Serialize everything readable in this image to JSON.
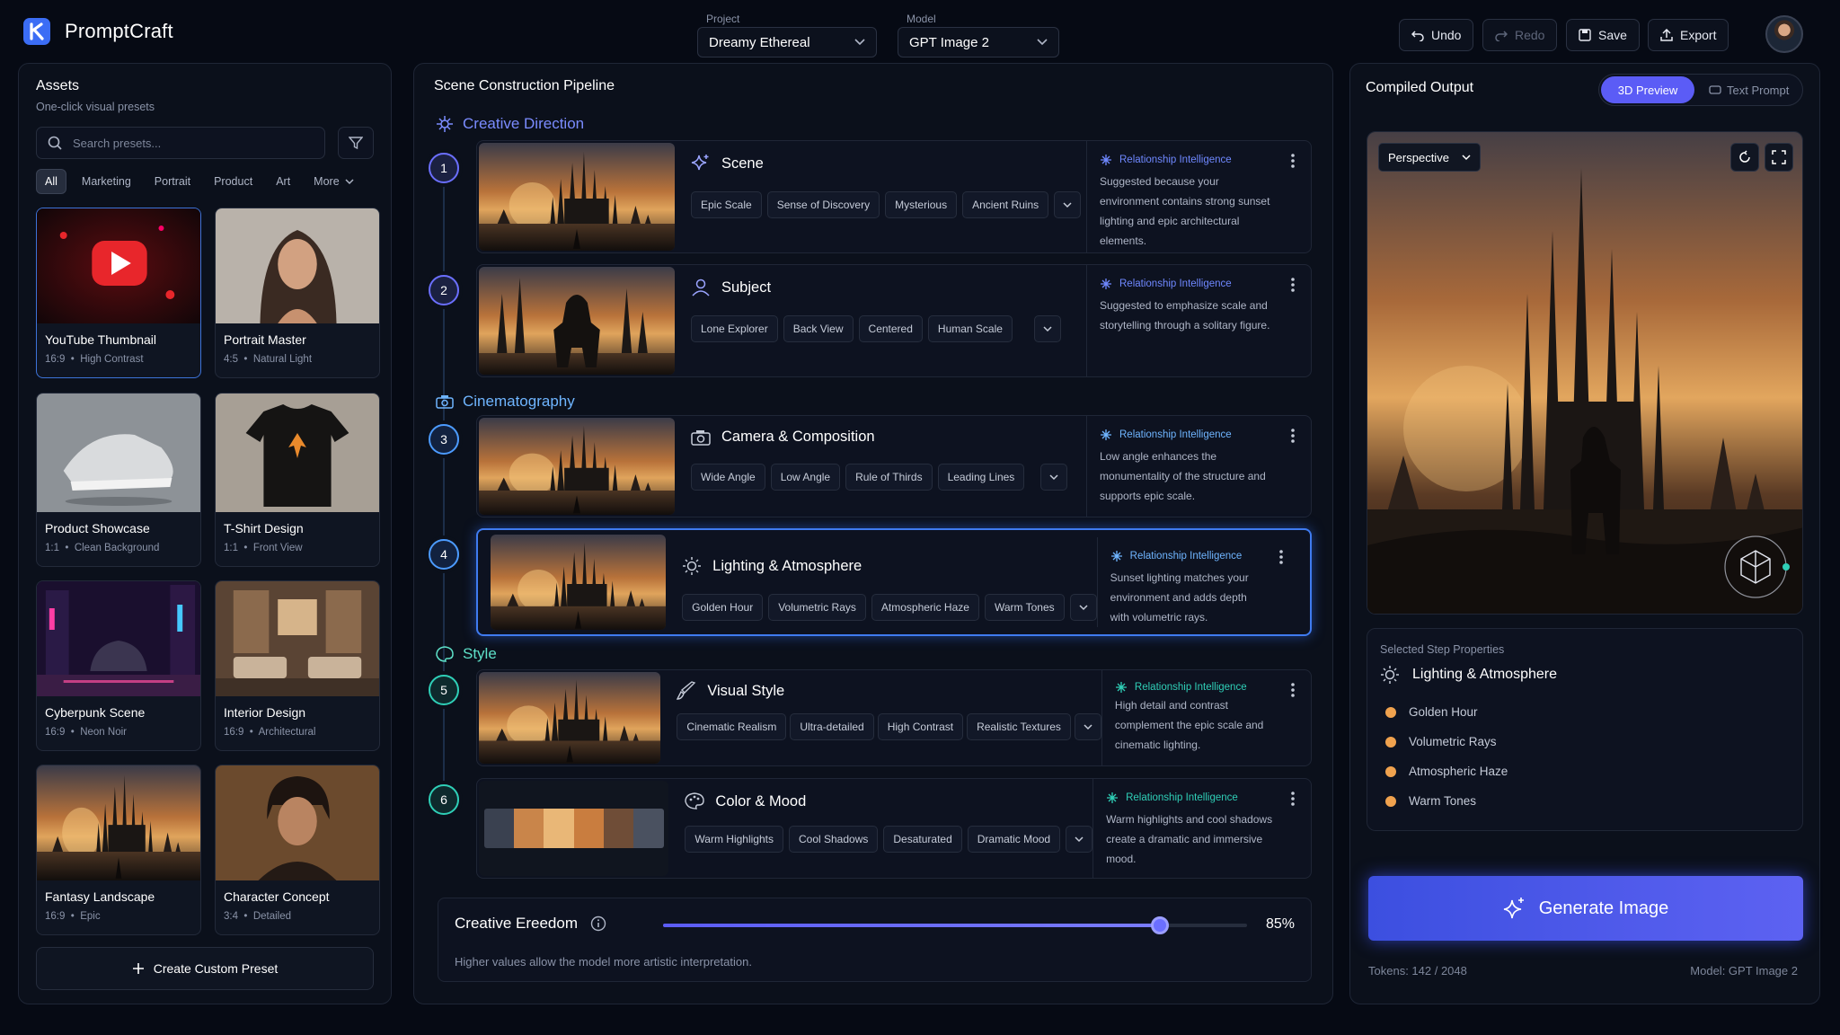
{
  "app": {
    "title": "PromptCraft"
  },
  "header": {
    "project_label": "Project",
    "project_value": "Dreamy Ethereal",
    "model_label": "Model",
    "model_value": "GPT Image 2",
    "undo": "Undo",
    "redo": "Redo",
    "save": "Save",
    "export": "Export"
  },
  "assets": {
    "title": "Assets",
    "subtitle": "One-click visual presets",
    "search_placeholder": "Search presets...",
    "filters": [
      "All",
      "Marketing",
      "Portrait",
      "Product",
      "Art",
      "More"
    ],
    "presets": [
      {
        "name": "YouTube Thumbnail",
        "ratio": "16:9",
        "detail": "High Contrast"
      },
      {
        "name": "Portrait Master",
        "ratio": "4:5",
        "detail": "Natural Light"
      },
      {
        "name": "Product Showcase",
        "ratio": "1:1",
        "detail": "Clean Background"
      },
      {
        "name": "T-Shirt Design",
        "ratio": "1:1",
        "detail": "Front View"
      },
      {
        "name": "Cyberpunk Scene",
        "ratio": "16:9",
        "detail": "Neon Noir"
      },
      {
        "name": "Interior Design",
        "ratio": "16:9",
        "detail": "Architectural"
      },
      {
        "name": "Fantasy Landscape",
        "ratio": "16:9",
        "detail": "Epic"
      },
      {
        "name": "Character Concept",
        "ratio": "3:4",
        "detail": "Detailed"
      }
    ],
    "create_button": "Create Custom Preset"
  },
  "pipeline": {
    "title": "Scene Construction Pipeline",
    "sections": [
      "Creative Direction",
      "Cinematography",
      "Style"
    ],
    "ri_label": "Relationship Intelligence",
    "steps": [
      {
        "num": "1",
        "title": "Scene",
        "tags": [
          "Epic Scale",
          "Sense of Discovery",
          "Mysterious",
          "Ancient Ruins"
        ],
        "reason": "Suggested because your environment contains strong sunset lighting and epic architectural elements."
      },
      {
        "num": "2",
        "title": "Subject",
        "tags": [
          "Lone Explorer",
          "Back View",
          "Centered",
          "Human Scale"
        ],
        "reason": "Suggested to emphasize scale and storytelling through a solitary figure."
      },
      {
        "num": "3",
        "title": "Camera & Composition",
        "tags": [
          "Wide Angle",
          "Low Angle",
          "Rule of Thirds",
          "Leading Lines"
        ],
        "reason": "Low angle enhances the monumentality of the structure and supports epic scale."
      },
      {
        "num": "4",
        "title": "Lighting & Atmosphere",
        "tags": [
          "Golden Hour",
          "Volumetric Rays",
          "Atmospheric Haze",
          "Warm Tones"
        ],
        "reason": "Sunset lighting matches your environment and adds depth with volumetric rays."
      },
      {
        "num": "5",
        "title": "Visual Style",
        "tags": [
          "Cinematic Realism",
          "Ultra-detailed",
          "High Contrast",
          "Realistic Textures"
        ],
        "reason": "High detail and contrast complement the epic scale and cinematic lighting."
      },
      {
        "num": "6",
        "title": "Color & Mood",
        "tags": [
          "Warm Highlights",
          "Cool Shadows",
          "Desaturated",
          "Dramatic Mood"
        ],
        "reason": "Warm highlights and cool shadows create a dramatic and immersive mood."
      }
    ],
    "palette": [
      "#3a4150",
      "#c9854a",
      "#e9b777",
      "#c97d3f",
      "#6f4d37",
      "#4a5160"
    ],
    "freedom": {
      "title": "Creative Ereedom",
      "value": 0.85,
      "value_label": "85%",
      "hint": "Higher values allow the model more artistic interpretation."
    }
  },
  "output": {
    "title": "Compiled Output",
    "tab_3d": "3D Preview",
    "tab_text": "Text Prompt",
    "view_select": "Perspective",
    "props_label": "Selected Step Properties",
    "props_title": "Lighting & Atmosphere",
    "props": [
      "Golden Hour",
      "Volumetric Rays",
      "Atmospheric Haze",
      "Warm Tones"
    ],
    "generate": "Generate Image",
    "tokens": "Tokens: 142 / 2048",
    "model": "Model: GPT Image 2"
  },
  "colors": {
    "accent": "#5b5cf6",
    "section_violet": "#7b8cff",
    "section_blue": "#6fb5ff",
    "section_teal": "#5ee0c8",
    "prop_dot": "#f0a24e"
  }
}
